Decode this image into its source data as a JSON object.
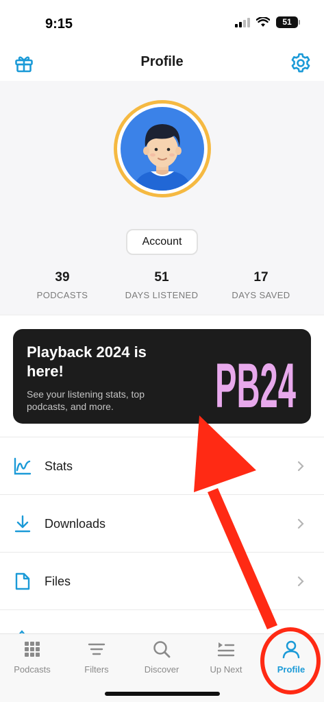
{
  "status_bar": {
    "time": "9:15",
    "battery": "51"
  },
  "header": {
    "title": "Profile",
    "gift_icon": "gift-icon",
    "settings_icon": "gear-icon"
  },
  "profile": {
    "account_label": "Account",
    "stats": [
      {
        "value": "39",
        "label": "PODCASTS"
      },
      {
        "value": "51",
        "label": "DAYS LISTENED"
      },
      {
        "value": "17",
        "label": "DAYS SAVED"
      }
    ]
  },
  "playback": {
    "title": "Playback 2024 is here!",
    "subtitle": "See your listening stats, top podcasts, and more.",
    "logo_text": "PB24",
    "logo_color": "#e8a9ec"
  },
  "menu": [
    {
      "label": "Stats",
      "icon": "stats-chart-icon"
    },
    {
      "label": "Downloads",
      "icon": "download-icon"
    },
    {
      "label": "Files",
      "icon": "file-icon"
    }
  ],
  "tabs": [
    {
      "label": "Podcasts",
      "icon": "grid-icon"
    },
    {
      "label": "Filters",
      "icon": "filter-lines-icon"
    },
    {
      "label": "Discover",
      "icon": "search-icon"
    },
    {
      "label": "Up Next",
      "icon": "queue-icon"
    },
    {
      "label": "Profile",
      "icon": "person-icon",
      "active": true
    }
  ],
  "colors": {
    "accent": "#1b9ad7",
    "annotation": "#ff2a14",
    "avatar_ring": "#f5b942",
    "avatar_bg": "#3b82e8"
  }
}
